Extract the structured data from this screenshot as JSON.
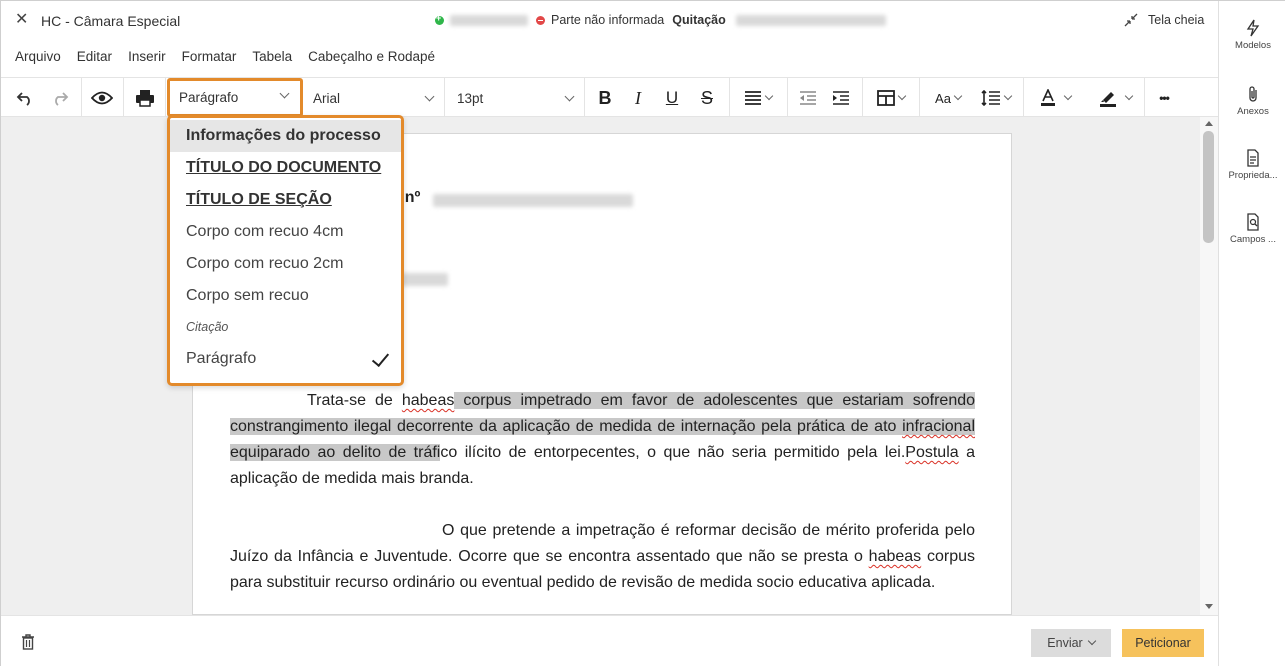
{
  "window": {
    "title": "HC - Câmara Especial",
    "party_missing": "Parte não informada",
    "party_status": "Quitação",
    "fullscreen_label": "Tela cheia"
  },
  "menu": [
    "Arquivo",
    "Editar",
    "Inserir",
    "Formatar",
    "Tabela",
    "Cabeçalho e Rodapé"
  ],
  "toolbar": {
    "paragraph_style": "Parágrafo",
    "font_family": "Arial",
    "font_size": "13pt",
    "bold": "B",
    "italic": "I",
    "underline": "U",
    "strike": "S",
    "case": "Aa",
    "more": "•••"
  },
  "style_dropdown": {
    "items": [
      "Informações do processo",
      "TÍTULO DO DOCUMENTO",
      "TÍTULO DE SEÇÃO",
      "Corpo com recuo 4cm",
      "Corpo com recuo 2cm",
      "Corpo sem recuo",
      "Citação",
      "Parágrafo"
    ],
    "selected": "Parágrafo"
  },
  "sidebar": {
    "items": [
      "Modelos",
      "Anexos",
      "Proprieda...",
      "Campos ..."
    ]
  },
  "document": {
    "number_prefix": ": nº",
    "para1_indent": "Trata-se de",
    "para1_word1": "habeas",
    "para1_hl1": " corpus impetrado em favor de adolescentes que estariam sofrendo constrangimento ilegal decorrente da aplicação de medida de internação pela prática de ato ",
    "para1_word2": "infracional",
    "para1_hl2": " equiparado ao delito de tráfi",
    "para1_rest1": "co ilícito de entorpecentes, o que não seria permitido pela lei.",
    "para1_word3": "Postula",
    "para1_rest2": " a aplicação de medida mais branda.",
    "para2_start": "O que pretende a impetração é reformar decisão de mérito proferida pelo Juízo da Infância e Juventude. Ocorre que se encontra assentado que não se presta o ",
    "para2_word": "habeas",
    "para2_rest": " corpus para substituir recurso ordinário ou eventual pedido de revisão de medida socio educativa aplicada."
  },
  "footer": {
    "send_label": "Enviar",
    "petition_label": "Peticionar"
  },
  "colors": {
    "accent_orange": "#e38a2b",
    "petition_button": "#f6c25c",
    "highlight": "#c8c8c8"
  }
}
